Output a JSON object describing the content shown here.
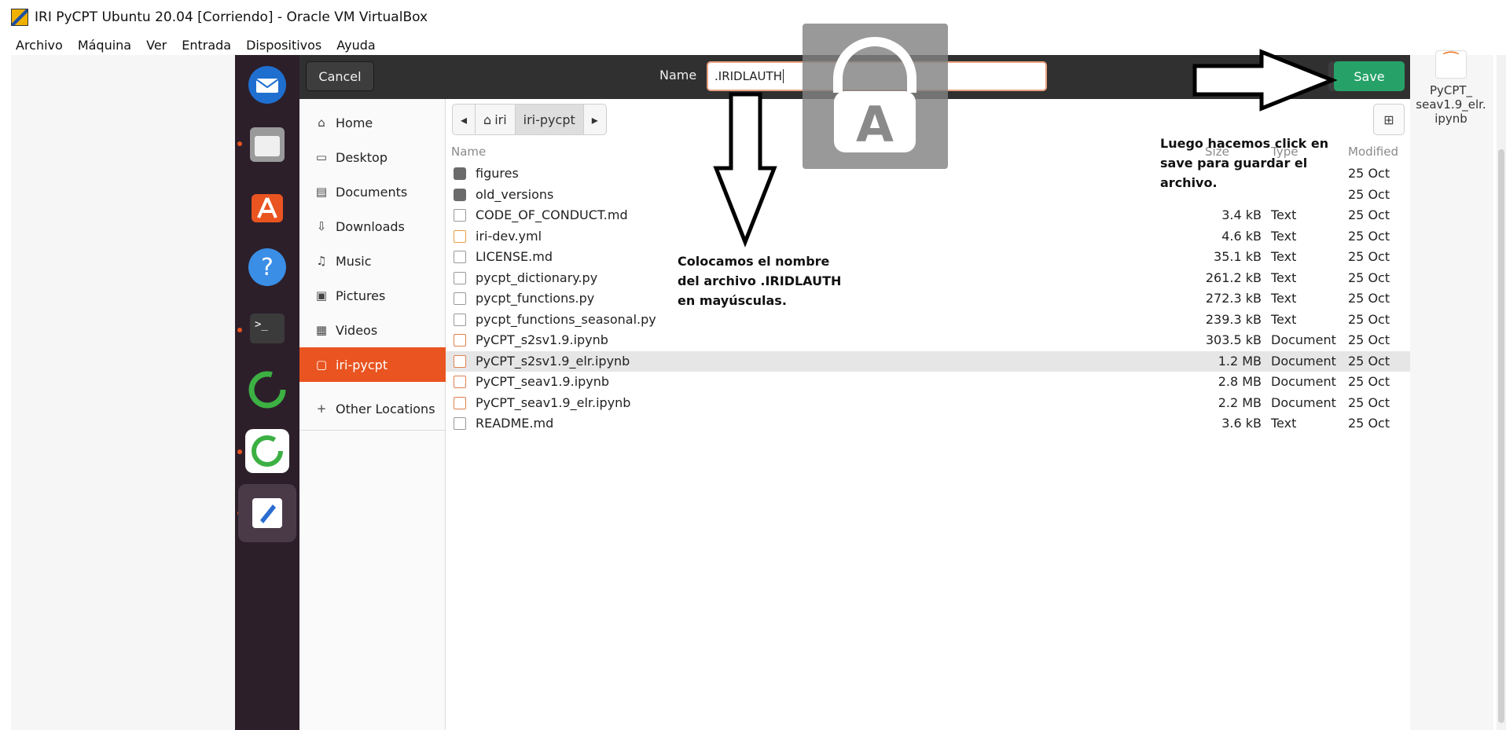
{
  "window": {
    "title": "IRI PyCPT Ubuntu 20.04 [Corriendo] - Oracle VM VirtualBox",
    "menu": [
      "Archivo",
      "Máquina",
      "Ver",
      "Entrada",
      "Dispositivos",
      "Ayuda"
    ]
  },
  "dialog": {
    "cancel_label": "Cancel",
    "name_label": "Name",
    "name_value": ".IRIDLAUTH",
    "save_label": "Save",
    "sidebar": [
      {
        "label": "Home",
        "icon": "home-icon"
      },
      {
        "label": "Desktop",
        "icon": "desktop-icon"
      },
      {
        "label": "Documents",
        "icon": "documents-icon"
      },
      {
        "label": "Downloads",
        "icon": "downloads-icon"
      },
      {
        "label": "Music",
        "icon": "music-icon"
      },
      {
        "label": "Pictures",
        "icon": "pictures-icon"
      },
      {
        "label": "Videos",
        "icon": "videos-icon"
      },
      {
        "label": "iri-pycpt",
        "icon": "folder-icon"
      },
      {
        "label": "Other Locations",
        "icon": "plus-icon"
      }
    ],
    "path": [
      "iri",
      "iri-pycpt"
    ],
    "columns": {
      "name": "Name",
      "size": "Size",
      "type": "Type",
      "modified": "Modified"
    },
    "files": [
      {
        "name": "figures",
        "size": "",
        "type": "",
        "modified": "25 Oct",
        "kind": "folder"
      },
      {
        "name": "old_versions",
        "size": "",
        "type": "",
        "modified": "25 Oct",
        "kind": "folder"
      },
      {
        "name": "CODE_OF_CONDUCT.md",
        "size": "3.4 kB",
        "type": "Text",
        "modified": "25 Oct",
        "kind": "md"
      },
      {
        "name": "iri-dev.yml",
        "size": "4.6 kB",
        "type": "Text",
        "modified": "25 Oct",
        "kind": "yml"
      },
      {
        "name": "LICENSE.md",
        "size": "35.1 kB",
        "type": "Text",
        "modified": "25 Oct",
        "kind": "md"
      },
      {
        "name": "pycpt_dictionary.py",
        "size": "261.2 kB",
        "type": "Text",
        "modified": "25 Oct",
        "kind": "py"
      },
      {
        "name": "pycpt_functions.py",
        "size": "272.3 kB",
        "type": "Text",
        "modified": "25 Oct",
        "kind": "py"
      },
      {
        "name": "pycpt_functions_seasonal.py",
        "size": "239.3 kB",
        "type": "Text",
        "modified": "25 Oct",
        "kind": "py"
      },
      {
        "name": "PyCPT_s2sv1.9.ipynb",
        "size": "303.5 kB",
        "type": "Document",
        "modified": "25 Oct",
        "kind": "nb"
      },
      {
        "name": "PyCPT_s2sv1.9_elr.ipynb",
        "size": "1.2 MB",
        "type": "Document",
        "modified": "25 Oct",
        "kind": "nb",
        "selected": true
      },
      {
        "name": "PyCPT_seav1.9.ipynb",
        "size": "2.8 MB",
        "type": "Document",
        "modified": "25 Oct",
        "kind": "nb"
      },
      {
        "name": "PyCPT_seav1.9_elr.ipynb",
        "size": "2.2 MB",
        "type": "Document",
        "modified": "25 Oct",
        "kind": "nb"
      },
      {
        "name": "README.md",
        "size": "3.6 kB",
        "type": "Text",
        "modified": "25 Oct",
        "kind": "md"
      }
    ]
  },
  "desktop_file": {
    "line1": "PyCPT_",
    "line2": "seav1.9_elr.",
    "line3": "ipynb"
  },
  "annotations": {
    "name_note": [
      "Colocamos el nombre",
      "del archivo .IRIDLAUTH",
      "en mayúsculas."
    ],
    "save_note": [
      "Luego hacemos click en",
      "save para guardar el",
      "archivo."
    ],
    "lock_letter": "A"
  },
  "colors": {
    "accent": "#e95420",
    "save": "#26a269",
    "headerbar": "#303030",
    "dock": "#2c1f2a"
  }
}
